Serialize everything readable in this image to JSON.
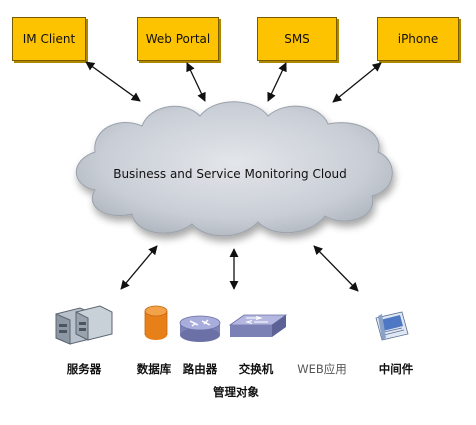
{
  "clients": [
    {
      "label": "IM Client"
    },
    {
      "label": "Web Portal"
    },
    {
      "label": "SMS"
    },
    {
      "label": "iPhone"
    }
  ],
  "cloud": {
    "label": "Business and Service Monitoring Cloud"
  },
  "managed_objects": [
    {
      "label": "服务器",
      "icon": "server-icon"
    },
    {
      "label": "数据库",
      "icon": "database-icon"
    },
    {
      "label": "路由器",
      "icon": "router-icon"
    },
    {
      "label": "交换机",
      "icon": "switch-icon"
    },
    {
      "label": "WEB应用",
      "icon": "none"
    },
    {
      "label": "中间件",
      "icon": "middleware-icon"
    }
  ],
  "group_label": "管理对象",
  "colors": {
    "client_box": "#fdc300",
    "cloud_fill": "#c9ced6",
    "arrow": "#111111",
    "database": "#e8801a",
    "router": "#8e93c7"
  }
}
